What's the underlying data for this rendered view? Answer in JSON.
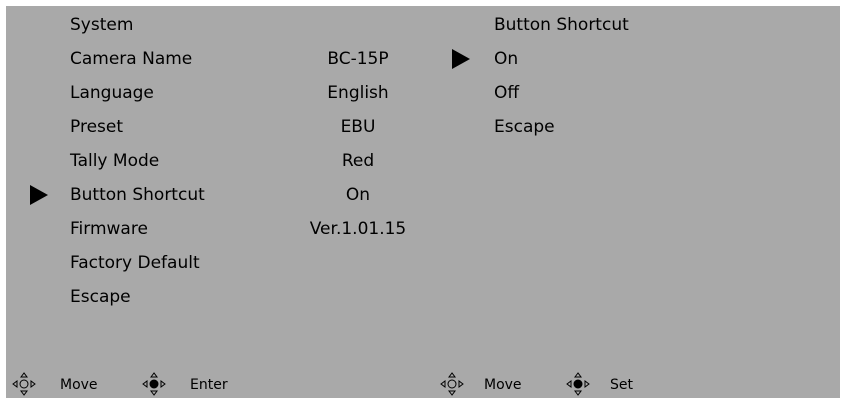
{
  "left_menu": {
    "items": [
      {
        "label": "System",
        "value": ""
      },
      {
        "label": "Camera Name",
        "value": "BC-15P"
      },
      {
        "label": "Language",
        "value": "English"
      },
      {
        "label": "Preset",
        "value": "EBU"
      },
      {
        "label": "Tally Mode",
        "value": "Red"
      },
      {
        "label": "Button Shortcut",
        "value": "On"
      },
      {
        "label": "Firmware",
        "value": "Ver.1.01.15"
      },
      {
        "label": "Factory Default",
        "value": ""
      },
      {
        "label": "Escape",
        "value": ""
      }
    ],
    "selected_index": 5
  },
  "right_menu": {
    "title": "Button Shortcut",
    "options": [
      "On",
      "Off",
      "Escape"
    ],
    "selected_index": 0
  },
  "footer_left": {
    "hints": [
      {
        "icon": "dpad-arrows-icon",
        "label": "Move"
      },
      {
        "icon": "dpad-center-icon",
        "label": "Enter"
      }
    ]
  },
  "footer_right": {
    "hints": [
      {
        "icon": "dpad-arrows-icon",
        "label": "Move"
      },
      {
        "icon": "dpad-center-icon",
        "label": "Set"
      }
    ]
  },
  "colors": {
    "panel_bg": "#a9a9a9",
    "text": "#000000"
  }
}
